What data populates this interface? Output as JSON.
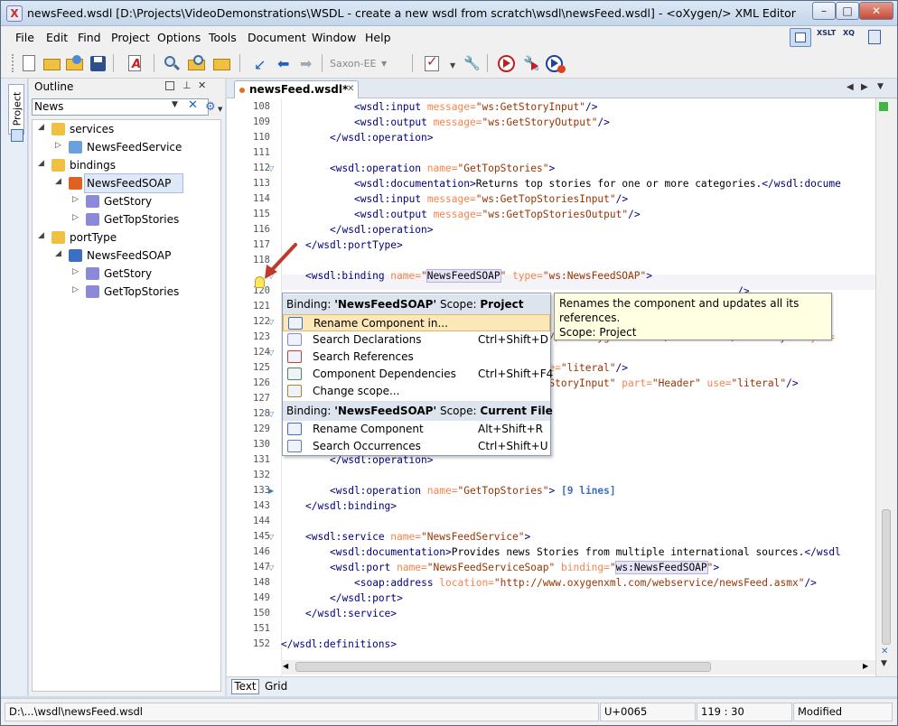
{
  "window": {
    "title": "newsFeed.wsdl [D:\\Projects\\VideoDemonstrations\\WSDL - create a new wsdl from scratch\\wsdl\\newsFeed.wsdl] - <oXygen/> XML Editor",
    "min": "–",
    "max": "□",
    "close": "✕"
  },
  "menu": [
    "File",
    "Edit",
    "Find",
    "Project",
    "Options",
    "Tools",
    "Document",
    "Window",
    "Help"
  ],
  "toolbar": {
    "transformer": "Saxon-EE"
  },
  "sidebar": {
    "project_tab": "Project"
  },
  "outline": {
    "title": "Outline",
    "filter_value": "News",
    "clear": "✕",
    "nodes": [
      {
        "level": 0,
        "label": "services",
        "exp": "◢",
        "icon": "folder-icon"
      },
      {
        "level": 1,
        "label": "NewsFeedService",
        "exp": "▷",
        "icon": "service-icon"
      },
      {
        "level": 0,
        "label": "bindings",
        "exp": "◢",
        "icon": "folder-icon"
      },
      {
        "level": 1,
        "label": "NewsFeedSOAP",
        "exp": "◢",
        "icon": "binding-icon",
        "selected": true
      },
      {
        "level": 2,
        "label": "GetStory",
        "exp": "▷",
        "icon": "operation-icon"
      },
      {
        "level": 2,
        "label": "GetTopStories",
        "exp": "▷",
        "icon": "operation-icon"
      },
      {
        "level": 0,
        "label": "portType",
        "exp": "◢",
        "icon": "folder-icon"
      },
      {
        "level": 1,
        "label": "NewsFeedSOAP",
        "exp": "◢",
        "icon": "porttype-icon"
      },
      {
        "level": 2,
        "label": "GetStory",
        "exp": "▷",
        "icon": "operation-icon"
      },
      {
        "level": 2,
        "label": "GetTopStories",
        "exp": "▷",
        "icon": "operation-icon"
      }
    ]
  },
  "editor": {
    "tab_label": "newsFeed.wsdl*",
    "view_tabs": [
      "Text",
      "Grid"
    ],
    "lines": [
      {
        "n": "108",
        "indent": 6,
        "fold": "",
        "seg": [
          [
            "tg",
            "<wsdl:input "
          ],
          [
            "an",
            "message="
          ],
          [
            "av",
            "\"ws:GetStoryInput\""
          ],
          [
            "tg",
            "/>"
          ]
        ]
      },
      {
        "n": "109",
        "indent": 6,
        "fold": "",
        "seg": [
          [
            "tg",
            "<wsdl:output "
          ],
          [
            "an",
            "message="
          ],
          [
            "av",
            "\"ws:GetStoryOutput\""
          ],
          [
            "tg",
            "/>"
          ]
        ]
      },
      {
        "n": "110",
        "indent": 4,
        "fold": "",
        "seg": [
          [
            "tg",
            "</wsdl:operation>"
          ]
        ]
      },
      {
        "n": "111",
        "indent": 0,
        "fold": "",
        "seg": []
      },
      {
        "n": "112",
        "indent": 4,
        "fold": "▽",
        "seg": [
          [
            "tg",
            "<wsdl:operation "
          ],
          [
            "an",
            "name="
          ],
          [
            "av",
            "\"GetTopStories\""
          ],
          [
            "tg",
            ">"
          ]
        ]
      },
      {
        "n": "113",
        "indent": 6,
        "fold": "",
        "seg": [
          [
            "tg",
            "<wsdl:documentation>"
          ],
          [
            "tx",
            "Returns top stories for one or more categories."
          ],
          [
            "tg",
            "</wsdl:docume"
          ]
        ]
      },
      {
        "n": "114",
        "indent": 6,
        "fold": "",
        "seg": [
          [
            "tg",
            "<wsdl:input "
          ],
          [
            "an",
            "message="
          ],
          [
            "av",
            "\"ws:GetTopStoriesInput\""
          ],
          [
            "tg",
            "/>"
          ]
        ]
      },
      {
        "n": "115",
        "indent": 6,
        "fold": "",
        "seg": [
          [
            "tg",
            "<wsdl:output "
          ],
          [
            "an",
            "message="
          ],
          [
            "av",
            "\"ws:GetTopStoriesOutput\""
          ],
          [
            "tg",
            "/>"
          ]
        ]
      },
      {
        "n": "116",
        "indent": 4,
        "fold": "",
        "seg": [
          [
            "tg",
            "</wsdl:operation>"
          ]
        ]
      },
      {
        "n": "117",
        "indent": 2,
        "fold": "",
        "seg": [
          [
            "tg",
            "</wsdl:portType>"
          ]
        ]
      },
      {
        "n": "118",
        "indent": 0,
        "fold": "",
        "seg": []
      },
      {
        "n": "",
        "indent": 2,
        "fold": "▽",
        "seg": [
          [
            "tg",
            "<wsdl:binding "
          ],
          [
            "an",
            "name="
          ],
          [
            "av",
            "\""
          ],
          [
            "hl",
            "NewsFeedSOAP"
          ],
          [
            "av",
            "\""
          ],
          [
            "tx",
            " "
          ],
          [
            "an",
            "type="
          ],
          [
            "av",
            "\"ws:NewsFeedSOAP\""
          ],
          [
            "tg",
            ">"
          ]
        ]
      },
      {
        "n": "120",
        "indent": 0,
        "fold": "",
        "seg": [
          [
            "tg",
            "                                                                           />"
          ]
        ]
      },
      {
        "n": "121",
        "indent": 0,
        "fold": "",
        "seg": []
      },
      {
        "n": "122",
        "indent": 0,
        "fold": "▽",
        "seg": []
      },
      {
        "n": "123",
        "indent": 0,
        "fold": "",
        "seg": [
          [
            "av",
            "                                          p://www.oxygenxml.com/webservice/GetStory\""
          ],
          [
            "tx",
            " "
          ],
          [
            "an",
            "style="
          ]
        ]
      },
      {
        "n": "124",
        "indent": 0,
        "fold": "▽",
        "seg": []
      },
      {
        "n": "125",
        "indent": 0,
        "fold": "",
        "seg": [
          [
            "an",
            "                                          use="
          ],
          [
            "av",
            "\"literal\""
          ],
          [
            "tg",
            "/>"
          ]
        ]
      },
      {
        "n": "126",
        "indent": 0,
        "fold": "",
        "seg": [
          [
            "av",
            "                                          etStoryInput\""
          ],
          [
            "tx",
            " "
          ],
          [
            "an",
            "part="
          ],
          [
            "av",
            "\"Header\""
          ],
          [
            "tx",
            " "
          ],
          [
            "an",
            "use="
          ],
          [
            "av",
            "\"literal\""
          ],
          [
            "tg",
            "/>"
          ]
        ]
      },
      {
        "n": "127",
        "indent": 0,
        "fold": "",
        "seg": []
      },
      {
        "n": "128",
        "indent": 0,
        "fold": "▽",
        "seg": []
      },
      {
        "n": "129",
        "indent": 0,
        "fold": "",
        "seg": [
          [
            "tg",
            "                                          />"
          ]
        ]
      },
      {
        "n": "130",
        "indent": 0,
        "fold": "",
        "seg": []
      },
      {
        "n": "131",
        "indent": 4,
        "fold": "",
        "seg": [
          [
            "tg",
            "</wsdl:operation>"
          ]
        ]
      },
      {
        "n": "132",
        "indent": 0,
        "fold": "",
        "seg": []
      },
      {
        "n": "133",
        "indent": 4,
        "fold": "▶",
        "seg": [
          [
            "tg",
            "<wsdl:operation "
          ],
          [
            "an",
            "name="
          ],
          [
            "av",
            "\"GetTopStories\""
          ],
          [
            "tg",
            ">"
          ],
          [
            "tx",
            " "
          ],
          [
            "fc",
            "[9 lines]"
          ]
        ]
      },
      {
        "n": "143",
        "indent": 2,
        "fold": "",
        "seg": [
          [
            "tg",
            "</wsdl:binding>"
          ]
        ]
      },
      {
        "n": "144",
        "indent": 0,
        "fold": "",
        "seg": []
      },
      {
        "n": "145",
        "indent": 2,
        "fold": "▽",
        "seg": [
          [
            "tg",
            "<wsdl:service "
          ],
          [
            "an",
            "name="
          ],
          [
            "av",
            "\"NewsFeedService\""
          ],
          [
            "tg",
            ">"
          ]
        ]
      },
      {
        "n": "146",
        "indent": 4,
        "fold": "",
        "seg": [
          [
            "tg",
            "<wsdl:documentation>"
          ],
          [
            "tx",
            "Provides news Stories from multiple international sources."
          ],
          [
            "tg",
            "</wsdl"
          ]
        ]
      },
      {
        "n": "147",
        "indent": 4,
        "fold": "▽",
        "seg": [
          [
            "tg",
            "<wsdl:port "
          ],
          [
            "an",
            "name="
          ],
          [
            "av",
            "\"NewsFeedServiceSoap\""
          ],
          [
            "tx",
            " "
          ],
          [
            "an",
            "binding="
          ],
          [
            "av",
            "\""
          ],
          [
            "hl",
            "ws:NewsFeedSOAP"
          ],
          [
            "av",
            "\""
          ],
          [
            "tg",
            ">"
          ]
        ]
      },
      {
        "n": "148",
        "indent": 6,
        "fold": "",
        "seg": [
          [
            "tg",
            "<soap:address "
          ],
          [
            "an",
            "location="
          ],
          [
            "av",
            "\"http://www.oxygenxml.com/webservice/newsFeed.asmx\""
          ],
          [
            "tg",
            "/>"
          ]
        ]
      },
      {
        "n": "149",
        "indent": 4,
        "fold": "",
        "seg": [
          [
            "tg",
            "</wsdl:port>"
          ]
        ]
      },
      {
        "n": "150",
        "indent": 2,
        "fold": "",
        "seg": [
          [
            "tg",
            "</wsdl:service>"
          ]
        ]
      },
      {
        "n": "151",
        "indent": 0,
        "fold": "",
        "seg": []
      },
      {
        "n": "152",
        "indent": 0,
        "fold": "",
        "seg": [
          [
            "tg",
            "</wsdl:definitions>"
          ]
        ]
      }
    ]
  },
  "popup": {
    "header1": {
      "binding_label": "Binding: ",
      "binding": "'NewsFeedSOAP'",
      "scope_label": "  Scope: ",
      "scope": "Project"
    },
    "group1": [
      {
        "label": "Rename Component in...",
        "key": "",
        "icon": "rename-icon"
      },
      {
        "label": "Search Declarations",
        "key": "Ctrl+Shift+D",
        "icon": "search-declarations-icon"
      },
      {
        "label": "Search References",
        "key": "",
        "icon": "search-references-icon"
      },
      {
        "label": "Component Dependencies",
        "key": "Ctrl+Shift+F4",
        "icon": "dependencies-icon"
      },
      {
        "label": "Change scope...",
        "key": "",
        "icon": "scope-icon"
      }
    ],
    "header2": {
      "binding_label": "Binding: ",
      "binding": "'NewsFeedSOAP'",
      "scope_label": "  Scope: ",
      "scope": "Current File"
    },
    "group2": [
      {
        "label": "Rename Component",
        "key": "Alt+Shift+R",
        "icon": "rename-icon"
      },
      {
        "label": "Search Occurrences",
        "key": "Ctrl+Shift+U",
        "icon": "search-occurrences-icon"
      }
    ]
  },
  "tooltip": {
    "line1": "Renames the component and updates all its references.",
    "line2": "Scope: Project"
  },
  "status": {
    "path": "D:\\...\\wsdl\\newsFeed.wsdl",
    "char": "U+0065",
    "position": "119 : 30",
    "state": "Modified"
  },
  "colors": {
    "accent": "#3a6fc2",
    "popup_hover": "#fce8b6",
    "tooltip_bg": "#ffffe1",
    "arrow": "#c0392b"
  }
}
